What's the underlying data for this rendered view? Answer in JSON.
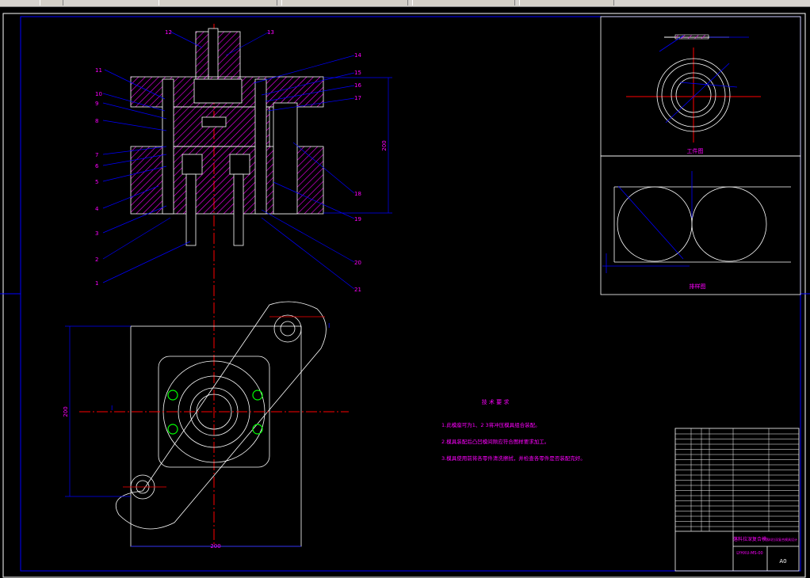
{
  "window": {
    "toolbar_tabs": [
      "",
      "",
      "",
      "",
      ""
    ]
  },
  "drawing": {
    "part_labels": [
      "1",
      "2",
      "3",
      "4",
      "5",
      "6",
      "7",
      "8",
      "9",
      "10",
      "11",
      "12",
      "13",
      "14",
      "15",
      "16",
      "17",
      "18",
      "19",
      "20",
      "21"
    ],
    "dim_height": "200",
    "dim_width": "200",
    "dim_side": "200",
    "section_mark_left": "I",
    "section_mark_right": "I",
    "workpiece_title": "工件图",
    "layout_title": "排样图",
    "tech_title": "技 术 要 求",
    "tech_notes": [
      "1.此模座可为1、2 3将冲压模具组合装配。",
      "2.模具装配后凸凹模间隙应符合图样要求加工。",
      "3.模具使用前将各零件清洗擦拭，并检查各零件是否装配完好。"
    ],
    "title_block": {
      "drawing_name": "落料拉深复合模",
      "drawing_number": "LYHXU-MS-00",
      "company": "落料拉深复合模具设计",
      "scale_label": "A0"
    }
  },
  "colors": {
    "background": "#000000",
    "frame": "#0000ff",
    "outline": "#ffffff",
    "centerline": "#ff0000",
    "dimension": "#0000ff",
    "hatch": "#ff00ff",
    "text_magenta": "#ff00ff",
    "bolt_holes": "#00ff00"
  }
}
